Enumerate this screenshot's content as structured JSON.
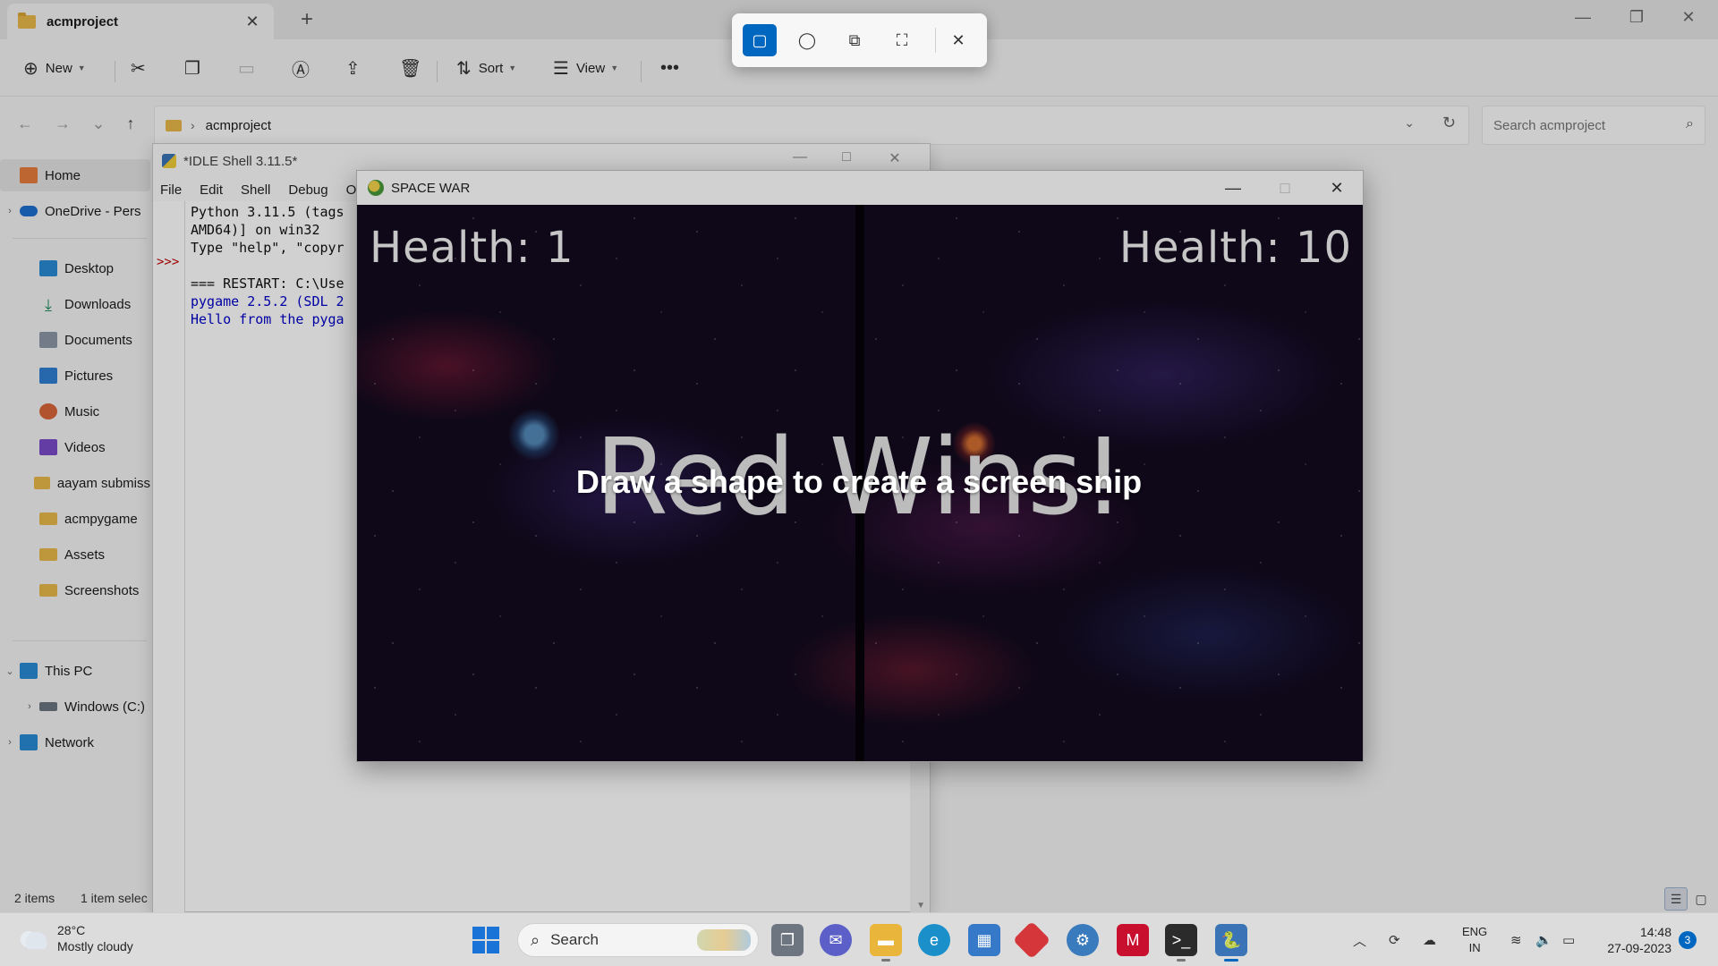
{
  "explorer": {
    "tab_title": "acmproject",
    "toolbar": {
      "new_label": "New",
      "sort_label": "Sort",
      "view_label": "View"
    },
    "breadcrumb": [
      "acmproject"
    ],
    "search_placeholder": "Search acmproject",
    "nav": {
      "home": "Home",
      "onedrive": "OneDrive - Pers",
      "desktop": "Desktop",
      "downloads": "Downloads",
      "documents": "Documents",
      "pictures": "Pictures",
      "music": "Music",
      "videos": "Videos",
      "folder1": "aayam submiss",
      "folder2": "acmpygame",
      "folder3": "Assets",
      "folder4": "Screenshots",
      "thispc": "This PC",
      "drive_c": "Windows (C:)",
      "network": "Network"
    },
    "status": {
      "items": "2 items",
      "selected": "1 item selec"
    }
  },
  "idle": {
    "title": "*IDLE Shell 3.11.5*",
    "menu": [
      "File",
      "Edit",
      "Shell",
      "Debug",
      "Op"
    ],
    "prompt": ">>>",
    "lines": [
      "Python 3.11.5 (tags",
      "AMD64)] on win32",
      "Type \"help\", \"copyr",
      "",
      "=== RESTART: C:\\Use",
      "pygame 2.5.2 (SDL 2",
      "Hello from the pyga"
    ]
  },
  "spacewar": {
    "title": "SPACE WAR",
    "left_health": "Health: 1",
    "right_health": "Health: 10",
    "winner_text": "Red Wins!"
  },
  "snip": {
    "hint": "Draw a shape to create a screen snip",
    "accent": "#0067c0"
  },
  "taskbar": {
    "weather_temp": "28°C",
    "weather_desc": "Mostly cloudy",
    "search_label": "Search",
    "lang_1": "ENG",
    "lang_2": "IN",
    "time": "14:48",
    "date": "27-09-2023",
    "notif_count": "3"
  }
}
